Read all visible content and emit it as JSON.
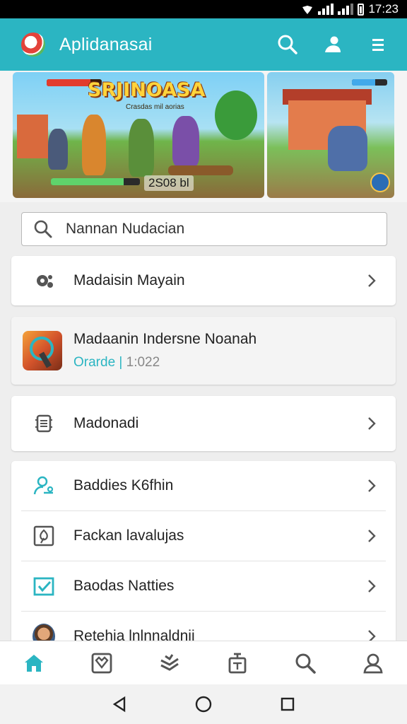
{
  "status_bar": {
    "time": "17:23",
    "icons": [
      "notification-icon",
      "signal-icon",
      "signal-icon",
      "battery-icon"
    ]
  },
  "app_bar": {
    "title": "Aplidanasai",
    "actions": [
      "search-icon",
      "account-icon",
      "menu-icon"
    ]
  },
  "banner": {
    "main": {
      "game_title": "SRJINOASA",
      "subtitle": "Crasdas mil aorias",
      "score": "2S08 bl",
      "health_level": 0.8,
      "stamina_level": 0.82
    },
    "side": {
      "energy_level": 0.65,
      "badge": "0"
    }
  },
  "search": {
    "placeholder": "Nannan Nudacian"
  },
  "menu_card": {
    "label": "Madaisin Mayain",
    "icon": "gear-icon"
  },
  "featured_app": {
    "name": "Madaanin Indersne Noanah",
    "category": "Orarde",
    "separator": "|",
    "meta_value": "1:022"
  },
  "single_item": {
    "label": "Madonadi",
    "icon": "device-icon"
  },
  "list_items": [
    {
      "label": "Baddies K6fhin",
      "icon": "user-add-icon"
    },
    {
      "label": "Fackan lavalujas",
      "icon": "shield-icon"
    },
    {
      "label": "Baodas Natties",
      "icon": "checkbox-icon"
    },
    {
      "label": "Retehia lnlnnaldnii",
      "icon": "avatar"
    }
  ],
  "bottom_nav": [
    {
      "icon": "home-icon",
      "active": true
    },
    {
      "icon": "gift-icon",
      "active": false
    },
    {
      "icon": "layers-icon",
      "active": false
    },
    {
      "icon": "store-icon",
      "active": false
    },
    {
      "icon": "search-icon",
      "active": false
    },
    {
      "icon": "profile-icon",
      "active": false
    }
  ],
  "system_nav": [
    "back-icon",
    "home-circle-icon",
    "recents-icon"
  ],
  "colors": {
    "accent": "#2bb5c2",
    "background": "#eeeeee",
    "icon_gray": "#555555"
  }
}
